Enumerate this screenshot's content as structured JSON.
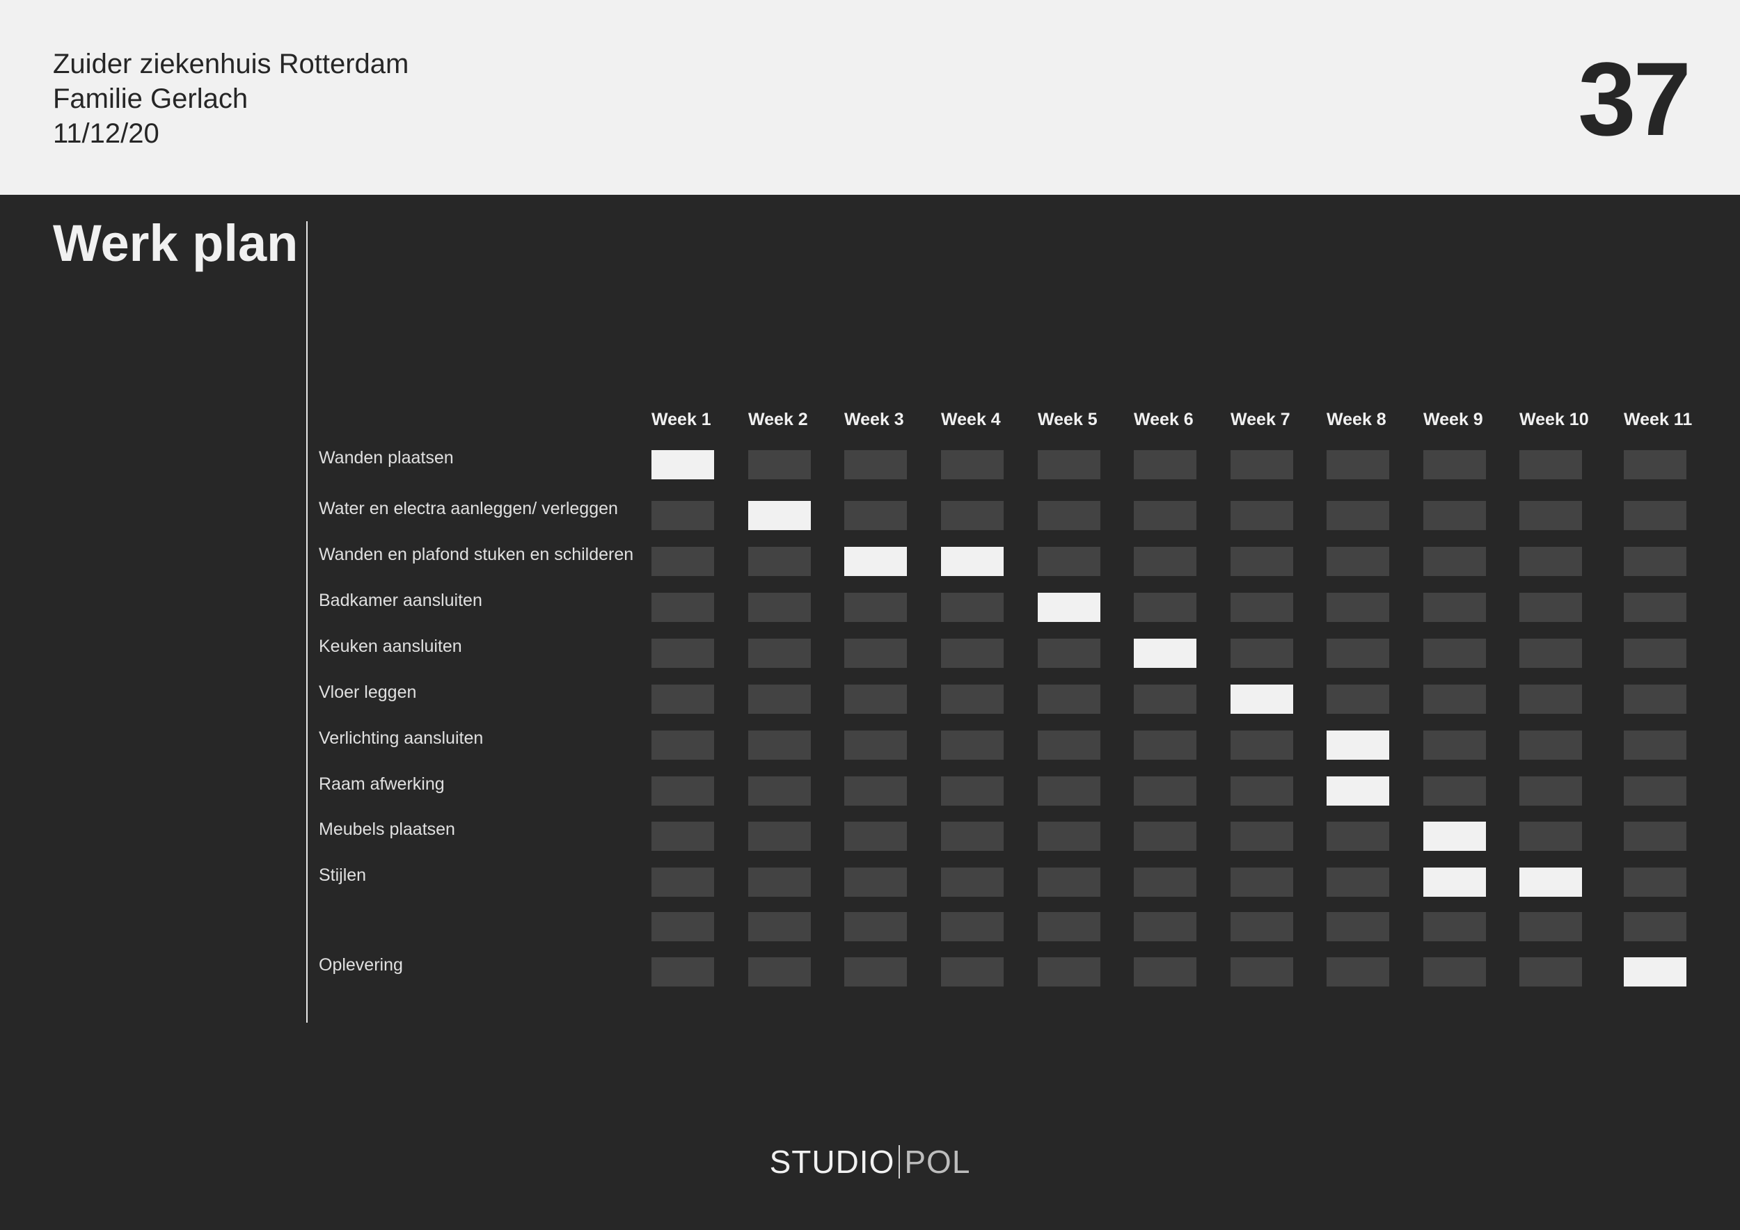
{
  "header": {
    "lines": [
      "Zuider ziekenhuis Rotterdam",
      "Familie Gerlach",
      "11/12/20"
    ],
    "page_number": "37"
  },
  "title": "Werk plan",
  "schedule": {
    "weeks": [
      "Week 1",
      "Week 2",
      "Week 3",
      "Week 4",
      "Week 5",
      "Week 6",
      "Week 7",
      "Week 8",
      "Week 9",
      "Week 10",
      "Week 11"
    ],
    "tasks": [
      {
        "label": "Wanden plaatsen",
        "active": [
          1
        ]
      },
      {
        "label": "Water en electra aanleggen/ verleggen",
        "active": [
          2
        ]
      },
      {
        "label": "Wanden en plafond stuken en schilderen",
        "active": [
          3,
          4
        ]
      },
      {
        "label": "Badkamer aansluiten",
        "active": [
          5
        ]
      },
      {
        "label": "Keuken aansluiten",
        "active": [
          6
        ]
      },
      {
        "label": "Vloer leggen",
        "active": [
          7
        ]
      },
      {
        "label": "Verlichting aansluiten",
        "active": [
          8
        ]
      },
      {
        "label": "Raam afwerking",
        "active": [
          8
        ]
      },
      {
        "label": "Meubels plaatsen",
        "active": [
          9
        ]
      },
      {
        "label": "Stijlen",
        "active": [
          9,
          10
        ]
      },
      {
        "label": "",
        "active": []
      },
      {
        "label": "Oplevering",
        "active": [
          11
        ]
      }
    ]
  },
  "brand": {
    "left": "STUDIO",
    "right": "POL"
  },
  "colors": {
    "light": "#f1f1f1",
    "dark": "#272727",
    "cell": "#434343"
  }
}
